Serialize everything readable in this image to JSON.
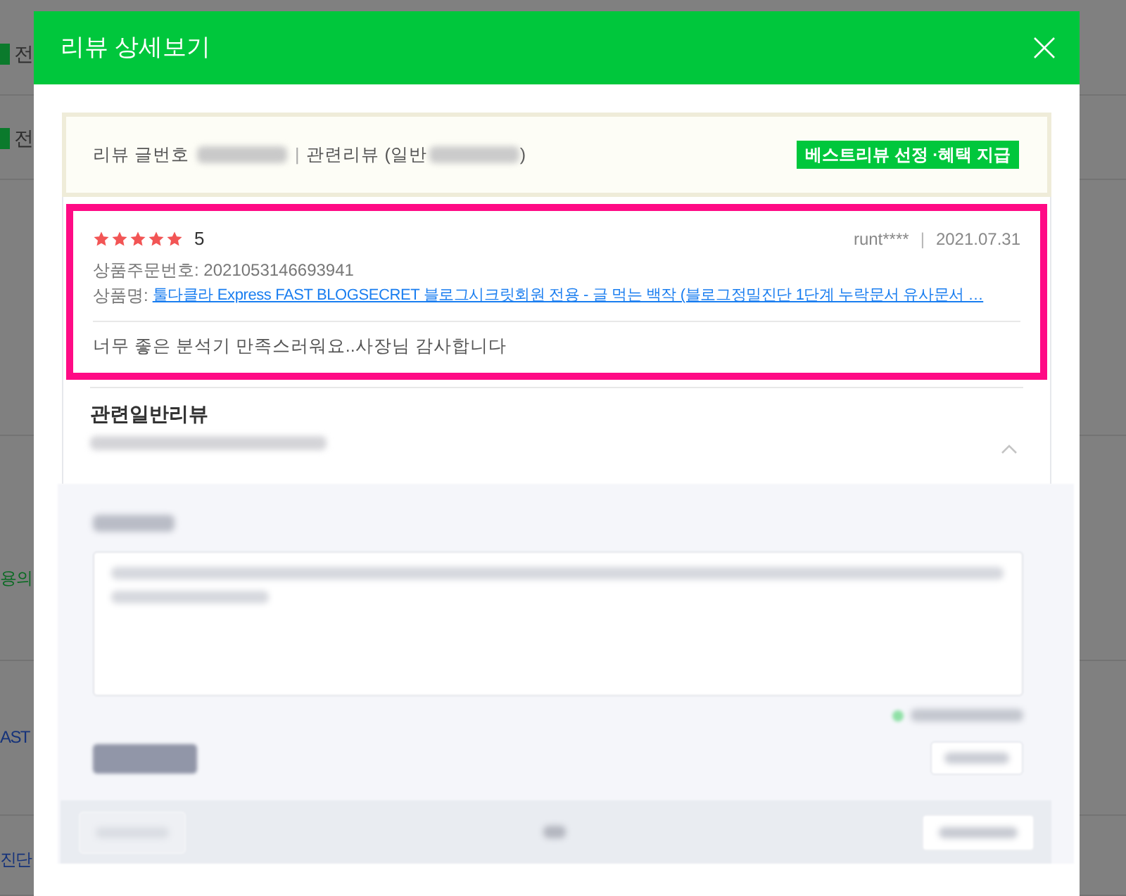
{
  "background": {
    "items": [
      {
        "kind": "checkbox",
        "checked": true,
        "text": "전"
      },
      {
        "kind": "checkbox",
        "checked": true,
        "text": "전"
      },
      {
        "kind": "green",
        "text": "용의"
      },
      {
        "kind": "link",
        "text": "AST"
      },
      {
        "kind": "link",
        "text": "진단"
      }
    ]
  },
  "modal": {
    "title": "리뷰 상세보기"
  },
  "info": {
    "review_number_label": "리뷰 글번호",
    "separator": "|",
    "related_label": "관련리뷰 (일반",
    "related_close": ")",
    "badge": "베스트리뷰 선정 ·혜택 지급"
  },
  "review": {
    "highlighted": true,
    "stars": 5,
    "score": "5",
    "author": "runt****",
    "separator": "|",
    "date": "2021.07.31",
    "order_number": "상품주문번호: 2021053146693941",
    "product_label": "상품명:",
    "product_link": "툴다클라 Express FAST BLOGSECRET 블로그시크릿회원 전용 - 글 먹는 백작 (블로그정밀진단 1단계 누락문서 유사문서 …",
    "text": "너무 좋은 분석기 만족스러워요..사장님 감사합니다"
  },
  "related_reviews": {
    "title": "관련일반리뷰",
    "expanded": true
  }
}
